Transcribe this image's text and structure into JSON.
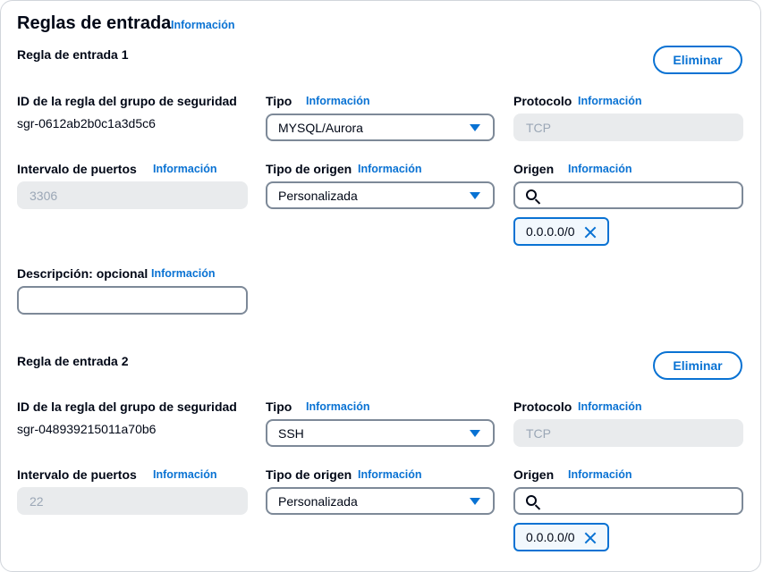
{
  "page": {
    "title": "Reglas de entrada",
    "info": "Información"
  },
  "labels": {
    "sg_rule_id": "ID de la regla del grupo de seguridad",
    "type": "Tipo",
    "protocol": "Protocolo",
    "port_range": "Intervalo de puertos",
    "source_type": "Tipo de origen",
    "source": "Origen",
    "description": "Descripción: opcional",
    "info": "Información",
    "delete": "Eliminar"
  },
  "rules": [
    {
      "heading": "Regla de entrada 1",
      "rule_id": "sgr-0612ab2b0c1a3d5c6",
      "type": "MYSQL/Aurora",
      "protocol": "TCP",
      "port_range": "3306",
      "source_type": "Personalizada",
      "source_search": "",
      "source_token": "0.0.0.0/0",
      "description": ""
    },
    {
      "heading": "Regla de entrada 2",
      "rule_id": "sgr-048939215011a70b6",
      "type": "SSH",
      "protocol": "TCP",
      "port_range": "22",
      "source_type": "Personalizada",
      "source_search": "",
      "source_token": "0.0.0.0/0"
    }
  ],
  "colors": {
    "accent": "#0972d3",
    "text": "#000716",
    "border": "#7d8998",
    "disabled_bg": "#e9ebed",
    "disabled_text": "#9ba7b6"
  }
}
